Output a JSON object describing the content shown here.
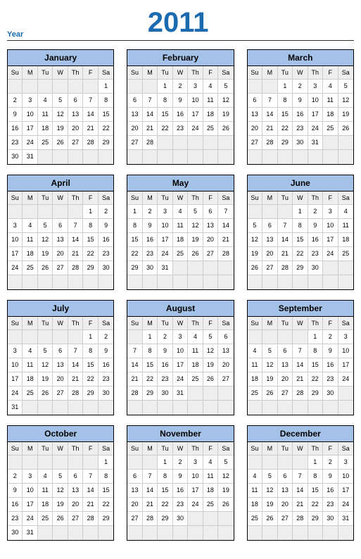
{
  "header": {
    "year_label": "Year",
    "year": "2011"
  },
  "weekdays": [
    "Su",
    "M",
    "Tu",
    "W",
    "Th",
    "F",
    "Sa"
  ],
  "months": [
    {
      "name": "January",
      "start": 6,
      "days": 31,
      "rows": 6
    },
    {
      "name": "February",
      "start": 2,
      "days": 28,
      "rows": 6
    },
    {
      "name": "March",
      "start": 2,
      "days": 31,
      "rows": 6
    },
    {
      "name": "April",
      "start": 5,
      "days": 30,
      "rows": 6
    },
    {
      "name": "May",
      "start": 0,
      "days": 31,
      "rows": 6
    },
    {
      "name": "June",
      "start": 3,
      "days": 30,
      "rows": 6
    },
    {
      "name": "July",
      "start": 5,
      "days": 31,
      "rows": 6
    },
    {
      "name": "August",
      "start": 1,
      "days": 31,
      "rows": 6
    },
    {
      "name": "September",
      "start": 4,
      "days": 30,
      "rows": 6
    },
    {
      "name": "October",
      "start": 6,
      "days": 31,
      "rows": 6
    },
    {
      "name": "November",
      "start": 2,
      "days": 30,
      "rows": 6
    },
    {
      "name": "December",
      "start": 4,
      "days": 31,
      "rows": 6
    }
  ]
}
